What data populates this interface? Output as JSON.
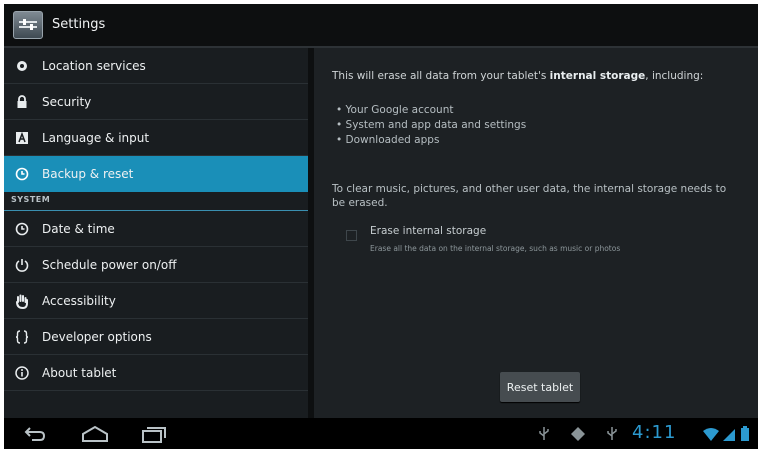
{
  "titlebar": {
    "title": "Settings"
  },
  "sidebar": {
    "items": [
      {
        "label": "Location services",
        "icon": "location-icon"
      },
      {
        "label": "Security",
        "icon": "lock-icon"
      },
      {
        "label": "Language & input",
        "icon": "keyboard-icon"
      },
      {
        "label": "Backup & reset",
        "icon": "backup-icon",
        "selected": true
      }
    ],
    "section_header": "SYSTEM",
    "system_items": [
      {
        "label": "Date & time",
        "icon": "clock-icon"
      },
      {
        "label": "Schedule power on/off",
        "icon": "power-clock-icon"
      },
      {
        "label": "Accessibility",
        "icon": "hand-icon"
      },
      {
        "label": "Developer options",
        "icon": "braces-icon"
      },
      {
        "label": "About tablet",
        "icon": "info-icon"
      }
    ]
  },
  "content": {
    "intro_prefix": "This will erase all data from your tablet's ",
    "intro_bold": "internal storage",
    "intro_suffix": ", including:",
    "bullets": [
      "Your Google account",
      "System and app data and settings",
      "Downloaded apps"
    ],
    "note": "To clear music, pictures, and other user data, the internal storage needs to be erased.",
    "erase_title": "Erase internal storage",
    "erase_subtitle": "Erase all the data on the internal storage, such as music or photos",
    "reset_button": "Reset tablet"
  },
  "status": {
    "time": "4:11"
  },
  "colors": {
    "accent": "#1a8fb8",
    "clock": "#2c9ad0"
  }
}
